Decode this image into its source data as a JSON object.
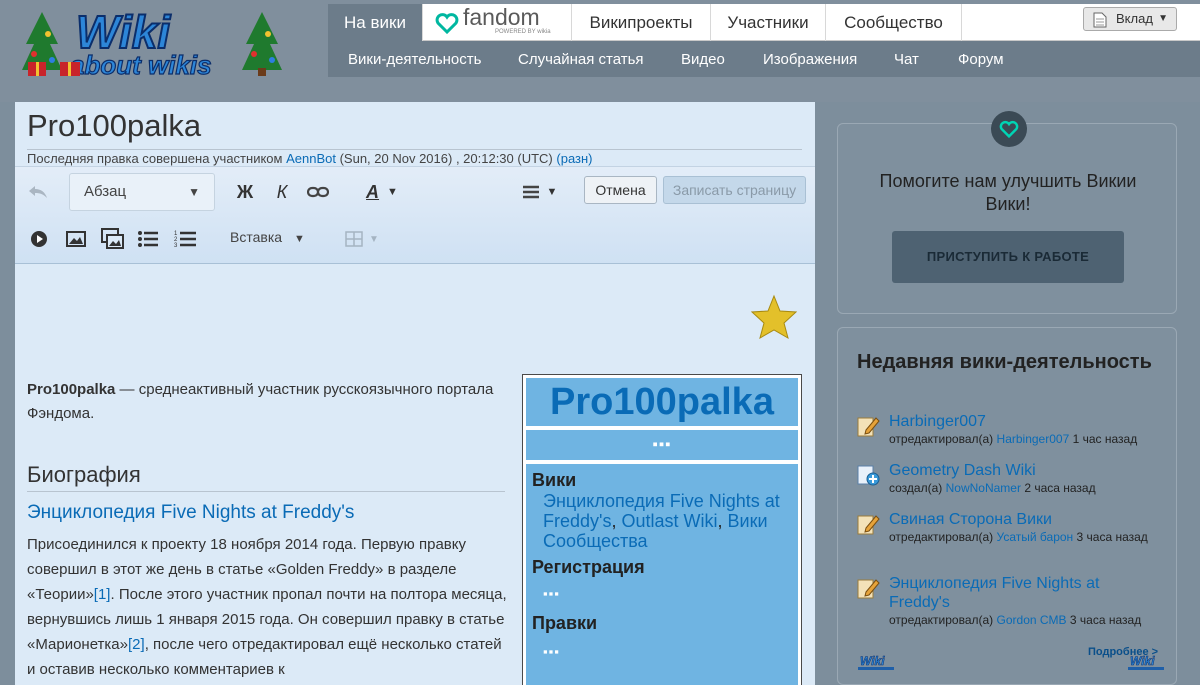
{
  "header": {
    "logo_alt": "Wiki about wikis",
    "top_tabs": [
      {
        "label": "На вики",
        "active": true
      },
      {
        "label": "fandom",
        "subtitle": "POWERED BY wikia"
      },
      {
        "label": "Википроекты"
      },
      {
        "label": "Участники"
      },
      {
        "label": "Сообщество"
      }
    ],
    "sub_tabs": [
      "Вики-деятельность",
      "Случайная статья",
      "Видео",
      "Изображения",
      "Чат",
      "Форум"
    ],
    "login_label": "Вклад"
  },
  "editor": {
    "page_title": "Pro100palka",
    "last_edit_prefix": "Последняя правка совершена участником",
    "last_edit_user": "AennBot",
    "last_edit_time": "(Sun, 20 Nov 2016) , 20:12:30 (UTC)",
    "diff_link": "(разн)",
    "format_label": "Абзац",
    "bold_label": "Ж",
    "italic_label": "К",
    "text_style_label": "А",
    "cancel_label": "Отмена",
    "save_label": "Записать страницу",
    "insert_label": "Вставка"
  },
  "content": {
    "intro_bold": "Pro100palka",
    "intro_text": " — среднеактивный участник русскоязычного портала Фэндома.",
    "bio_heading": "Биография",
    "sub_heading": "Энциклопедия Five Nights at Freddy's",
    "bio_p1": "Присоединился к проекту 18 ноября 2014 года. Первую правку совершил в этот же день в статье «Golden Freddy» в разделе «Теории»",
    "ref1": "[1]",
    "bio_p2": ". После этого участник пропал почти на полтора месяца, вернувшись лишь 1 января 2015 года. Он совершил правку в статье «Марионетка»",
    "ref2": "[2]",
    "bio_p3": ", после чего отредактировал ещё несколько статей и оставив несколько комментариев к"
  },
  "infobox": {
    "title": "Pro100palka",
    "dots": "▪▪▪",
    "wiki_heading": "Вики",
    "wiki_link1": "Энциклопедия Five Nights at Freddy's",
    "wiki_link2": "Outlast Wiki",
    "wiki_link3": "Вики Сообщества",
    "reg_heading": "Регистрация",
    "edits_heading": "Правки"
  },
  "rail": {
    "help_text": "Помогите нам улучшить Викии Вики!",
    "start_button": "ПРИСТУПИТЬ К РАБОТЕ",
    "activity_heading": "Недавняя вики-деятельность",
    "activity": [
      {
        "title": "Harbinger007",
        "action": "отредактировал(а)",
        "user": "Harbinger007",
        "time": "1 час назад",
        "icon": "edit-icon"
      },
      {
        "title": "Geometry Dash Wiki",
        "action": "создал(а)",
        "user": "NowNoNamer",
        "time": "2 часа назад",
        "icon": "create-icon"
      },
      {
        "title": "Свиная Сторона Вики",
        "action": "отредактировал(а)",
        "user": "Усатый барон",
        "time": "3 часа назад",
        "icon": "edit-icon"
      },
      {
        "title": "Энциклопедия Five Nights at Freddy's",
        "action": "отредактировал(а)",
        "user": "Gordon CMB",
        "time": "3 часа назад",
        "icon": "edit-icon"
      }
    ],
    "more_link": "Подробнее >"
  },
  "colors": {
    "accent": "#0a6bb6",
    "nav_active": "#6c7c8a",
    "infobox": "#6fb4e2",
    "editor_bg": "#dceaf7"
  }
}
